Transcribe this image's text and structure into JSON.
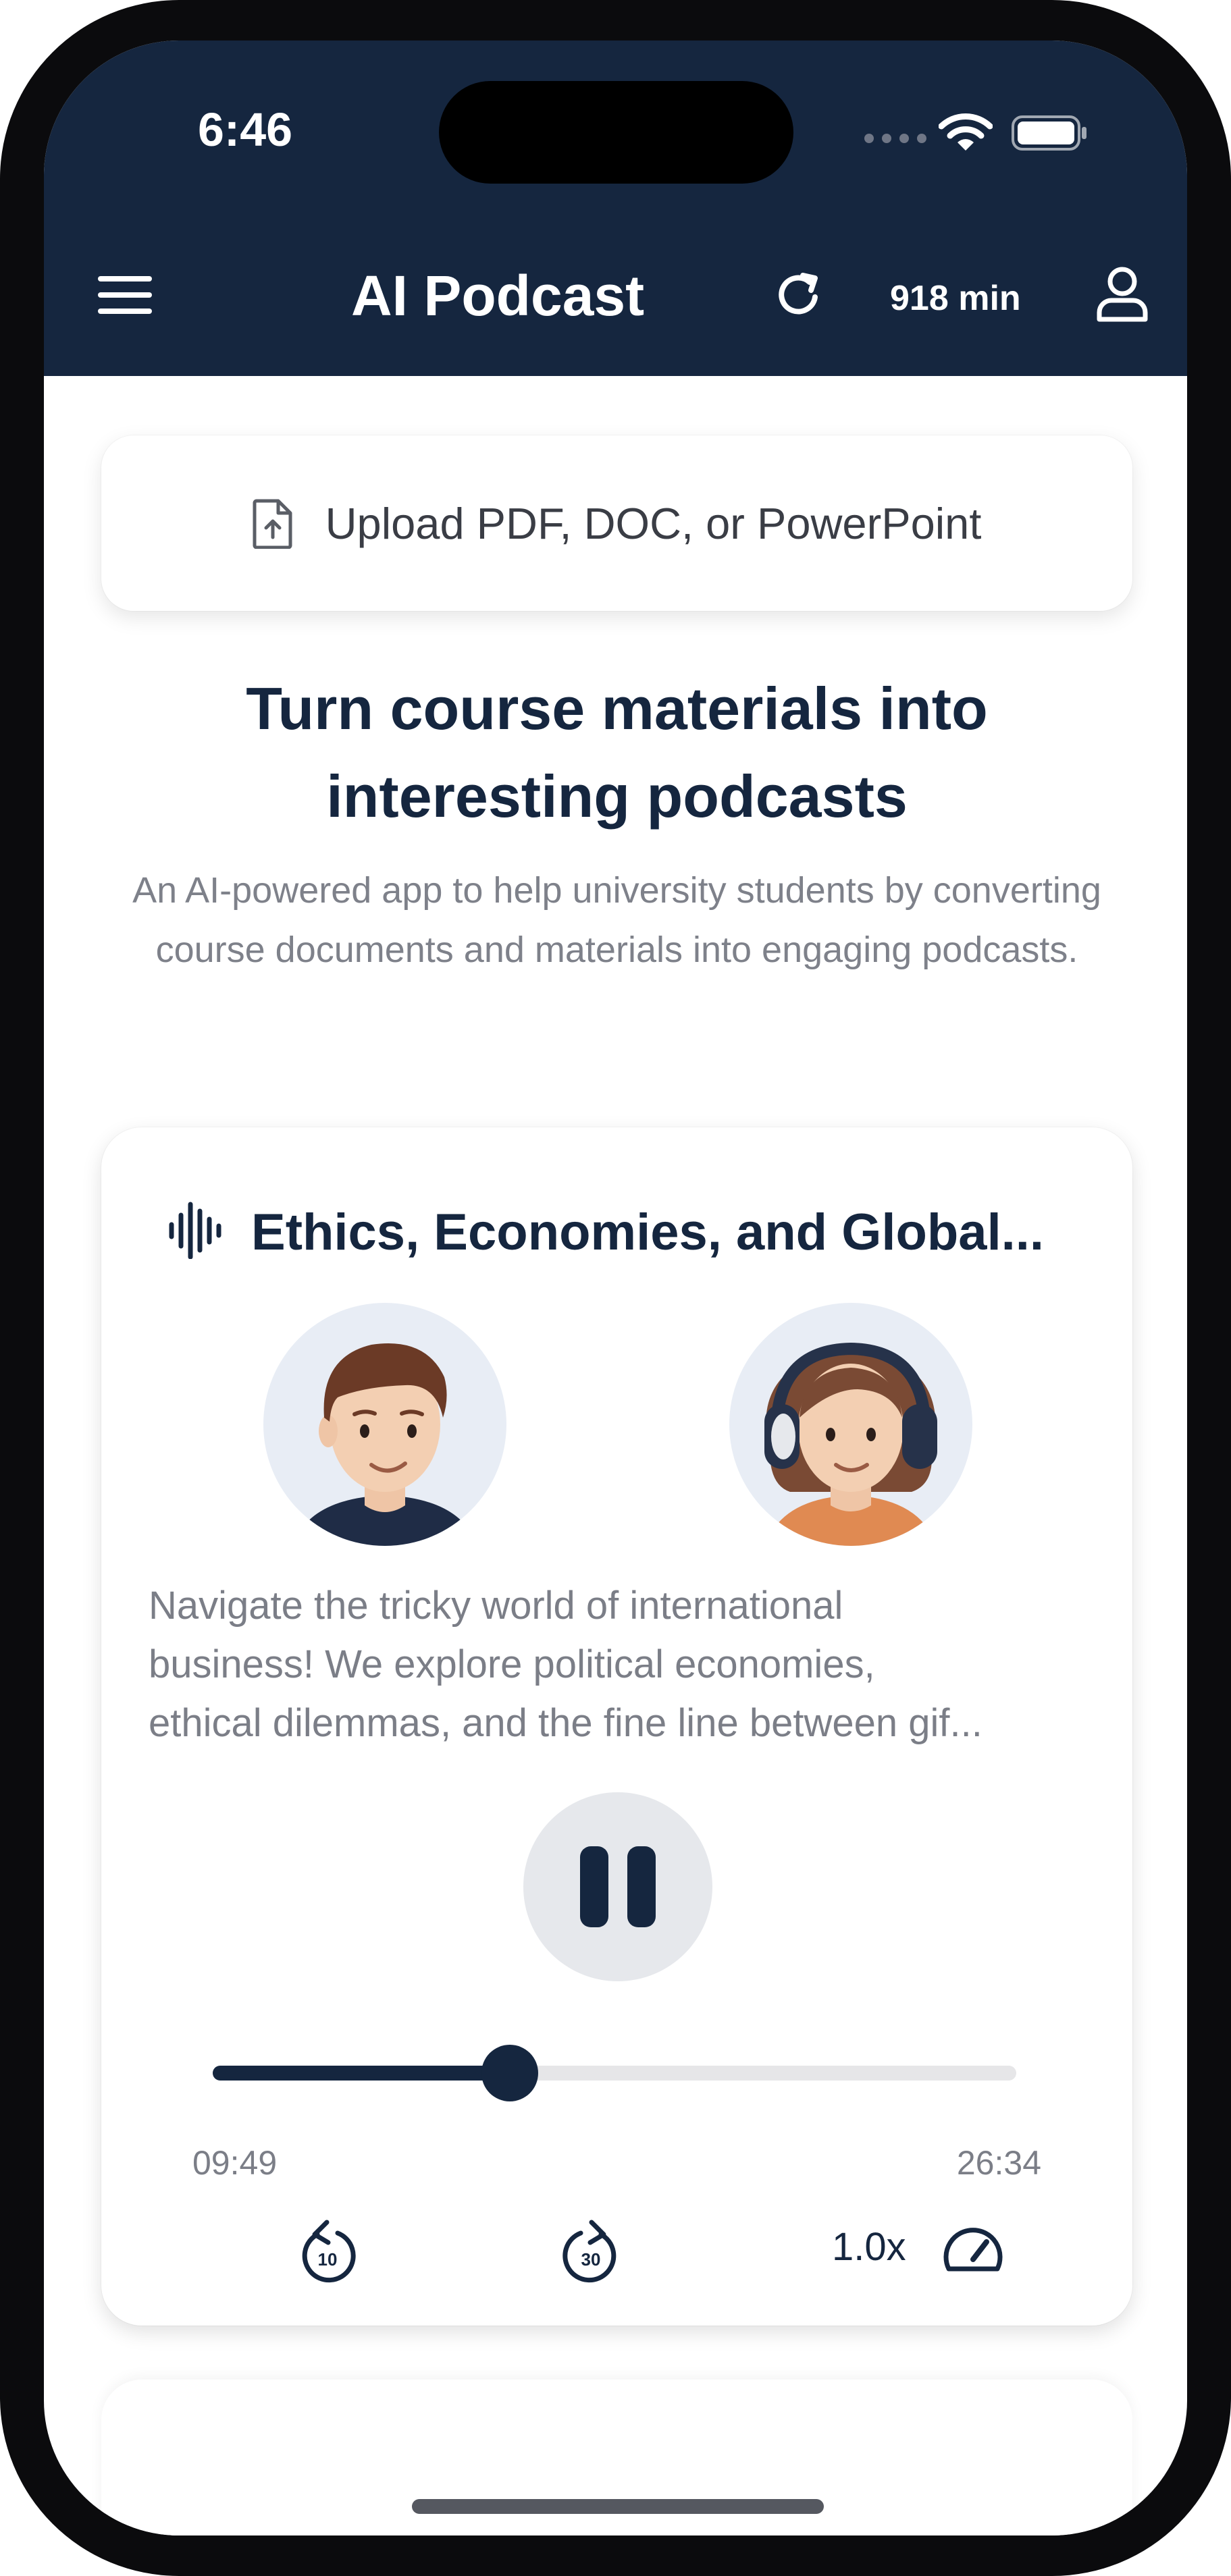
{
  "status_bar": {
    "time": "6:46"
  },
  "header": {
    "title": "AI Podcast",
    "minutes": "918 min"
  },
  "upload": {
    "label": "Upload PDF, DOC, or PowerPoint"
  },
  "hero": {
    "title_line1": "Turn course materials into",
    "title_line2": "interesting podcasts",
    "subtitle": "An AI-powered app to help university students by converting course documents and materials into engaging podcasts."
  },
  "episode": {
    "title": "Ethics, Economies, and Global...",
    "description_lines": [
      "Navigate the tricky world of international",
      "business! We explore political economies,",
      "ethical dilemmas, and the fine line between gif..."
    ],
    "current_time": "09:49",
    "total_time": "26:34",
    "progress_fraction": 0.37,
    "speed": "1.0x",
    "skip_back_seconds": "10",
    "skip_forward_seconds": "30"
  },
  "colors": {
    "navy": "#15263f",
    "muted": "#7b7e87"
  },
  "icons": [
    "menu-icon",
    "refresh-icon",
    "profile-icon",
    "upload-file-icon",
    "waveform-icon",
    "pause-icon",
    "skip-back-10-icon",
    "skip-forward-30-icon",
    "speedometer-icon",
    "wifi-icon",
    "battery-icon"
  ]
}
